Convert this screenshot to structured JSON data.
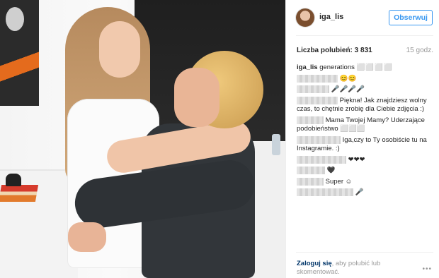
{
  "header": {
    "username": "iga_lis",
    "follow_label": "Obserwuj"
  },
  "stats": {
    "likes": "Liczba polubień: 3 831",
    "time": "15 godz."
  },
  "caption": {
    "user": "iga_lis",
    "text": "generations",
    "suffix": "⬜⬜⬜⬜"
  },
  "comments": [
    {
      "text": "😊😊"
    },
    {
      "text": "🎤🎤🎤🎤"
    },
    {
      "text": "Piękna! Jak znajdziesz wolny czas, to chętnie zrobię dla Ciebie zdjęcia :)"
    },
    {
      "text": "Mama Twojej Mamy? Uderzające podobieństwo ⬜⬜⬜"
    },
    {
      "text": "Iga,czy to Ty osobiście tu na Instagramie. :)"
    },
    {
      "text": "❤❤❤"
    },
    {
      "text": "🖤"
    },
    {
      "text": "Super ☺"
    },
    {
      "text": "🎤"
    }
  ],
  "footer": {
    "login_link": "Zaloguj się",
    "login_rest": ", aby polubić lub skomentować.",
    "more": "•••"
  },
  "icons": {
    "avatar": "profile-avatar",
    "more": "more-options-icon"
  },
  "colors": {
    "accent": "#3897f0",
    "link": "#003569",
    "muted": "#999999"
  }
}
